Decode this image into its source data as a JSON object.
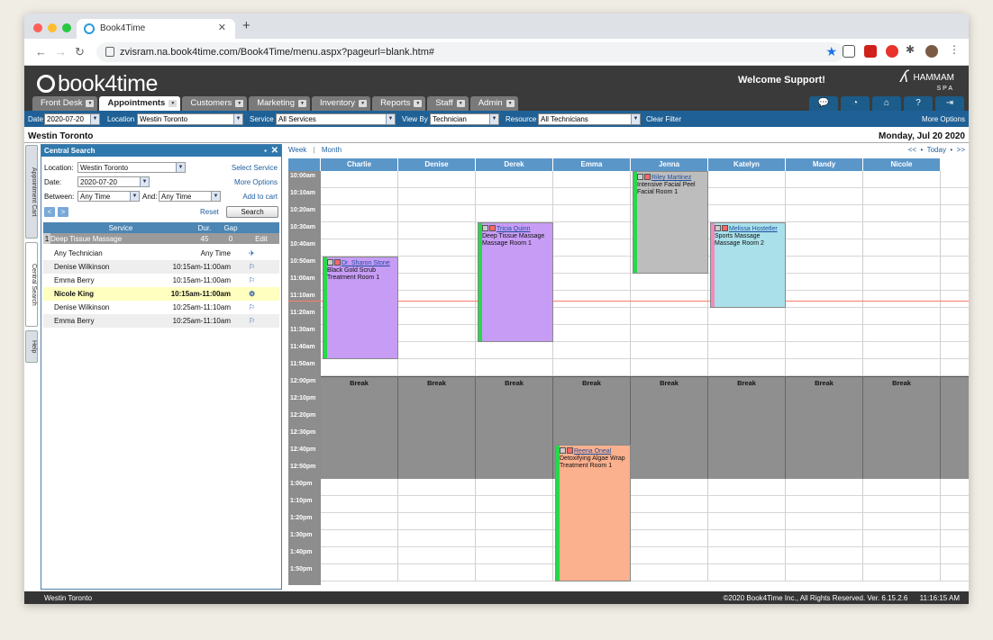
{
  "browser": {
    "tab_title": "Book4Time",
    "url": "zvisram.na.book4time.com/Book4Time/menu.aspx?pageurl=blank.htm#"
  },
  "header": {
    "logo_text": "book4time",
    "welcome": "Welcome Support!",
    "brand": "HAMMAM",
    "brand_sub": "SPA"
  },
  "menu_tabs": [
    {
      "label": "Front Desk"
    },
    {
      "label": "Appointments",
      "active": true
    },
    {
      "label": "Customers"
    },
    {
      "label": "Marketing"
    },
    {
      "label": "Inventory"
    },
    {
      "label": "Reports"
    },
    {
      "label": "Staff"
    },
    {
      "label": "Admin"
    }
  ],
  "header_icons": [
    "chat-icon",
    "dashboard-icon",
    "home-icon",
    "help-icon",
    "logout-icon"
  ],
  "filters": {
    "date_label": "Date",
    "date_value": "2020-07-20",
    "location_label": "Location",
    "location_value": "Westin Toronto",
    "service_label": "Service",
    "service_value": "All Services",
    "viewby_label": "View By",
    "viewby_value": "Technician",
    "resource_label": "Resource",
    "resource_value": "All Technicians",
    "clear": "Clear Filter",
    "more": "More Options"
  },
  "location_title": "Westin Toronto",
  "date_title": "Monday, Jul 20 2020",
  "rail": {
    "cart": "Appointment Cart",
    "search": "Central Search",
    "help": "Help"
  },
  "search": {
    "title": "Central Search",
    "location_label": "Location:",
    "location_value": "Westin Toronto",
    "select_service": "Select Service",
    "date_label": "Date:",
    "date_value": "2020-07-20",
    "more_options": "More Options",
    "between_label": "Between:",
    "between_value": "Any Time",
    "and_label": "And:",
    "and_value": "Any Time",
    "add_to_cart": "Add to cart",
    "reset": "Reset",
    "search_btn": "Search",
    "columns": [
      "Service",
      "Dur.",
      "Gap",
      ""
    ],
    "service_row": {
      "num": "1",
      "name": "Deep Tissue Massage",
      "dur": "45",
      "gap": "0",
      "edit": "Edit"
    },
    "results": [
      {
        "name": "Any Technician",
        "time": "Any Time",
        "highlight": false
      },
      {
        "name": "Denise Wilkinson",
        "time": "10:15am-11:00am",
        "highlight": false
      },
      {
        "name": "Emma Berry",
        "time": "10:15am-11:00am",
        "highlight": false
      },
      {
        "name": "Nicole King",
        "time": "10:15am-11:00am",
        "highlight": true
      },
      {
        "name": "Denise Wilkinson",
        "time": "10:25am-11:10am",
        "highlight": false
      },
      {
        "name": "Emma Berry",
        "time": "10:25am-11:10am",
        "highlight": false
      }
    ]
  },
  "scheduler": {
    "week": "Week",
    "month": "Month",
    "prev": "<<",
    "today": "Today",
    "next": ">>",
    "technicians": [
      "Charlie",
      "Denise",
      "Derek",
      "Emma",
      "Jenna",
      "Katelyn",
      "Mandy",
      "Nicole"
    ],
    "times": [
      "10:00am",
      "10:10am",
      "10:20am",
      "10:30am",
      "10:40am",
      "10:50am",
      "11:00am",
      "11:10am",
      "11:20am",
      "11:30am",
      "11:40am",
      "11:50am",
      "12:00pm",
      "12:10pm",
      "12:20pm",
      "12:30pm",
      "12:40pm",
      "12:50pm",
      "1:00pm",
      "1:10pm",
      "1:20pm",
      "1:30pm",
      "1:40pm",
      "1:50pm"
    ],
    "break_label": "Break",
    "appointments": [
      {
        "col": 0,
        "start": 5,
        "span": 6,
        "client": "Dr. Sharon Stone",
        "service": "Black Gold Scrub",
        "room": "Treatment Room 1",
        "color": "#c79cf5",
        "bar": "#27d84a"
      },
      {
        "col": 2,
        "start": 3,
        "span": 7,
        "client": "Tricia Quinn",
        "service": "Deep Tissue Massage",
        "room": "Massage Room 1",
        "color": "#c79cf5",
        "bar": "#27d84a"
      },
      {
        "col": 4,
        "start": 0,
        "span": 6,
        "client": "Riley Martinez",
        "service": "Intensive Facial Peel",
        "room": "Facial Room 1",
        "color": "#bdbdbd",
        "bar": "#27d84a"
      },
      {
        "col": 5,
        "start": 3,
        "span": 5,
        "client": "Melissa Hostetler",
        "service": "Sports Massage",
        "room": "Massage Room 2",
        "color": "#a9e0ea",
        "bar": "#f08bbd"
      },
      {
        "col": 3,
        "start": 16,
        "span": 8,
        "client": "Reena Oneal",
        "service": "Detoxifying Algae Wrap",
        "room": "Treatment Room 1",
        "color": "#fbb08e",
        "bar": "#27d84a"
      }
    ]
  },
  "status": {
    "location": "Westin Toronto",
    "copyright": "©2020 Book4Time Inc., All Rights Reserved. Ver. 6.15.2.6",
    "time": "11:16:15 AM"
  }
}
